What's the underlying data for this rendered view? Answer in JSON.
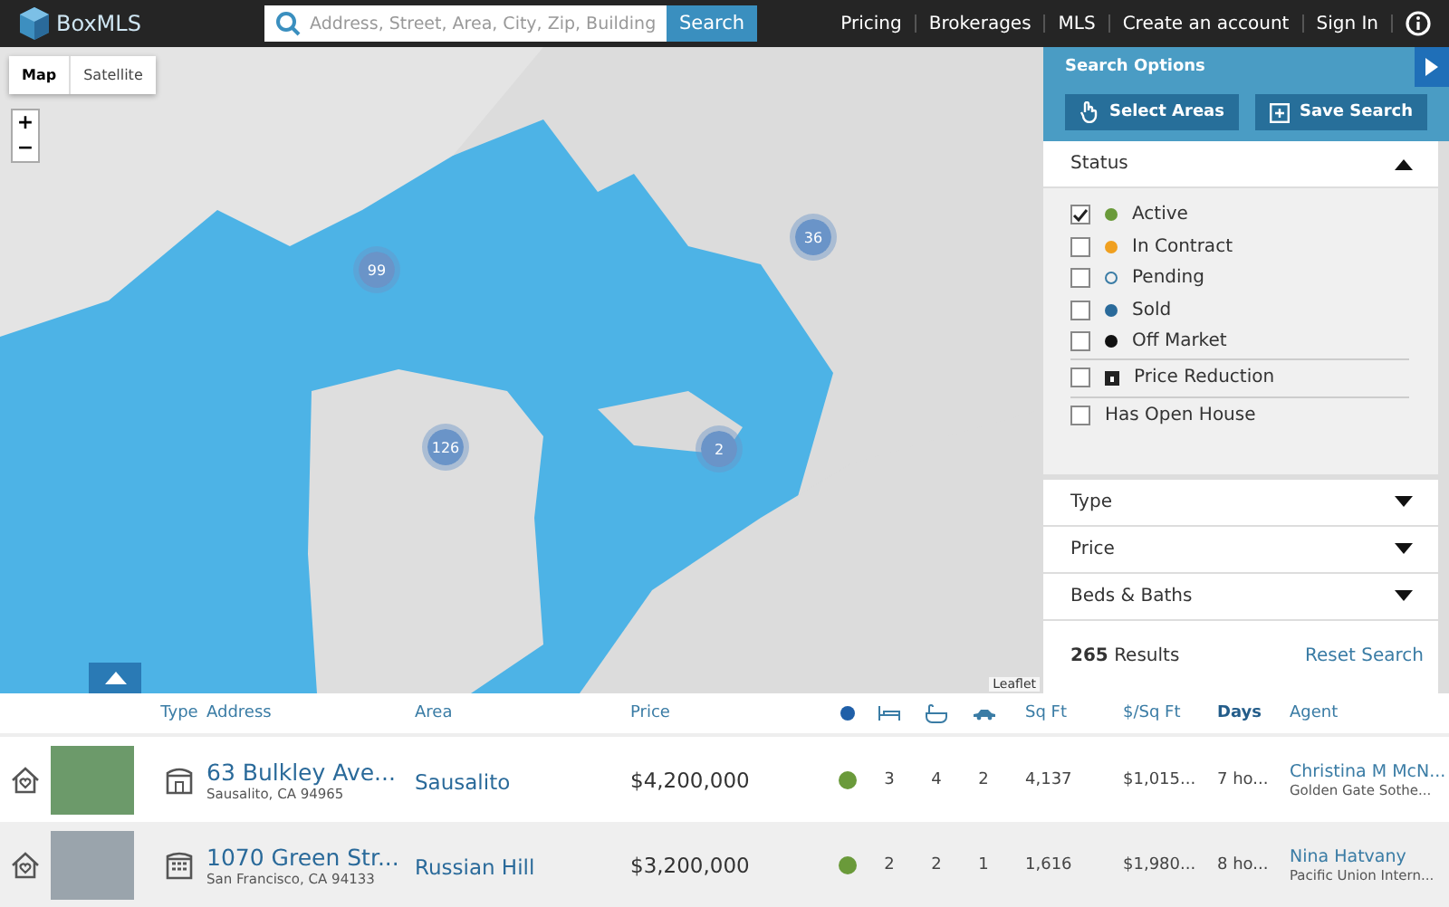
{
  "header": {
    "logo": "BoxMLS",
    "search_placeholder": "Address, Street, Area, City, Zip, Building",
    "search_button": "Search",
    "nav": [
      "Pricing",
      "Brokerages",
      "MLS",
      "Create an account",
      "Sign In"
    ]
  },
  "map": {
    "toggle": [
      {
        "label": "Map",
        "selected": true
      },
      {
        "label": "Satellite",
        "selected": false
      }
    ],
    "zoom_in": "+",
    "zoom_out": "−",
    "clusters": [
      "99",
      "36",
      "126",
      "2"
    ],
    "attribution": "Leaflet"
  },
  "search_options": {
    "title": "Search Options",
    "buttons": [
      "Select Areas",
      "Save Search"
    ],
    "status": {
      "label": "Status",
      "expanded": true,
      "items": [
        {
          "label": "Active",
          "checked": true,
          "kind": "dot",
          "color": "#6a9a3a"
        },
        {
          "label": "In Contract",
          "checked": false,
          "kind": "dot",
          "color": "#f0a020"
        },
        {
          "label": "Pending",
          "checked": false,
          "kind": "ring",
          "color": "#3a7ca5"
        },
        {
          "label": "Sold",
          "checked": false,
          "kind": "dot",
          "color": "#2a6a9a"
        },
        {
          "label": "Off Market",
          "checked": false,
          "kind": "dot",
          "color": "#111111"
        },
        {
          "label": "Price Reduction",
          "checked": false,
          "kind": "icon"
        },
        {
          "label": "Has Open House",
          "checked": false,
          "kind": "plain"
        }
      ]
    },
    "sections": [
      {
        "label": "Type",
        "expanded": false
      },
      {
        "label": "Price",
        "expanded": false
      },
      {
        "label": "Beds & Baths",
        "expanded": false
      }
    ],
    "results_count": "265",
    "results_label": "Results",
    "reset": "Reset Search"
  },
  "table": {
    "columns": {
      "type": "Type",
      "address": "Address",
      "area": "Area",
      "price": "Price",
      "sqft": "Sq Ft",
      "price_sqft": "$/Sq Ft",
      "days": "Days",
      "agent": "Agent"
    },
    "rows": [
      {
        "kind": "house",
        "address": "63 Bulkley Ave...",
        "city": "Sausalito, CA 94965",
        "area": "Sausalito",
        "price": "$4,200,000",
        "color": "#6a9a3a",
        "beds": "3",
        "baths": "4",
        "parking": "2",
        "sqft": "4,137",
        "price_sqft": "$1,015...",
        "days": "7 ho...",
        "agent": "Christina M McN...",
        "brokerage": "Golden Gate Sothe..."
      },
      {
        "kind": "building",
        "address": "1070 Green Str...",
        "city": "San Francisco, CA 94133",
        "area": "Russian Hill",
        "price": "$3,200,000",
        "color": "#6a9a3a",
        "beds": "2",
        "baths": "2",
        "parking": "1",
        "sqft": "1,616",
        "price_sqft": "$1,980...",
        "days": "8 ho...",
        "agent": "Nina Hatvany",
        "brokerage": "Pacific Union Intern..."
      }
    ]
  }
}
